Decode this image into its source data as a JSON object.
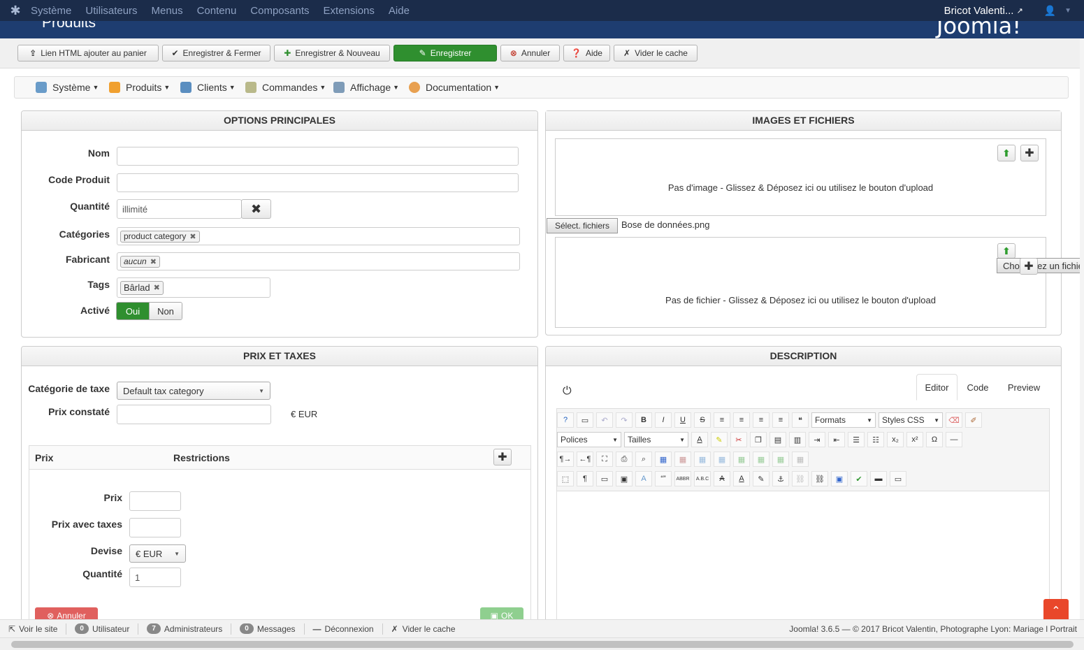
{
  "topnav": {
    "menu": [
      "Système",
      "Utilisateurs",
      "Menus",
      "Contenu",
      "Composants",
      "Extensions",
      "Aide"
    ],
    "user": "Bricot Valenti..."
  },
  "header": {
    "title": "Produits",
    "brand": "Joomla!"
  },
  "toolbar": {
    "html_link": "Lien HTML ajouter au panier",
    "save_close": "Enregistrer & Fermer",
    "save_new": "Enregistrer & Nouveau",
    "save": "Enregistrer",
    "cancel": "Annuler",
    "help": "Aide",
    "clear_cache": "Vider le cache"
  },
  "component_menu": [
    "Système",
    "Produits",
    "Clients",
    "Commandes",
    "Affichage",
    "Documentation"
  ],
  "main_options": {
    "heading": "OPTIONS PRINCIPALES",
    "name_label": "Nom",
    "code_label": "Code Produit",
    "qty_label": "Quantité",
    "qty_value": "illimité",
    "cat_label": "Catégories",
    "cat_tag": "product category",
    "mfr_label": "Fabricant",
    "mfr_tag": "aucun",
    "tags_label": "Tags",
    "tag_value": "Bârlad",
    "active_label": "Activé",
    "yes": "Oui",
    "no": "Non"
  },
  "images": {
    "heading": "IMAGES ET FICHIERS",
    "no_image": "Pas d'image - Glissez & Déposez ici ou utilisez le bouton d'upload",
    "select_files": "Sélect. fichiers",
    "selected_file": "Bose de données.png",
    "choose_file": "Choisissez un fichier",
    "no_file": "Pas de fichier - Glissez & Déposez ici ou utilisez le bouton d'upload"
  },
  "prices": {
    "heading": "PRIX ET TAXES",
    "tax_label": "Catégorie de taxe",
    "tax_value": "Default tax category",
    "msrp_label": "Prix constaté",
    "currency_suffix": "€ EUR",
    "col_price": "Prix",
    "col_restrictions": "Restrictions",
    "price_label": "Prix",
    "price_tax_label": "Prix avec taxes",
    "currency_label": "Devise",
    "currency_value": "€ EUR",
    "quantity_label": "Quantité",
    "quantity_value": "1",
    "cancel": "Annuler",
    "ok": "OK"
  },
  "description": {
    "heading": "DESCRIPTION",
    "tabs": [
      "Editor",
      "Code",
      "Preview"
    ],
    "formats": "Formats",
    "styles": "Styles CSS",
    "fonts": "Polices",
    "sizes": "Tailles"
  },
  "statusbar": {
    "view_site": "Voir le site",
    "users_count": "0",
    "users_label": "Utilisateur",
    "admins_count": "7",
    "admins_label": "Administrateurs",
    "messages_count": "0",
    "messages_label": "Messages",
    "logout": "Déconnexion",
    "clear_cache": "Vider le cache",
    "footer": "Joomla! 3.6.5  —  © 2017 Bricot Valentin, Photographe Lyon: Mariage l Portrait"
  }
}
